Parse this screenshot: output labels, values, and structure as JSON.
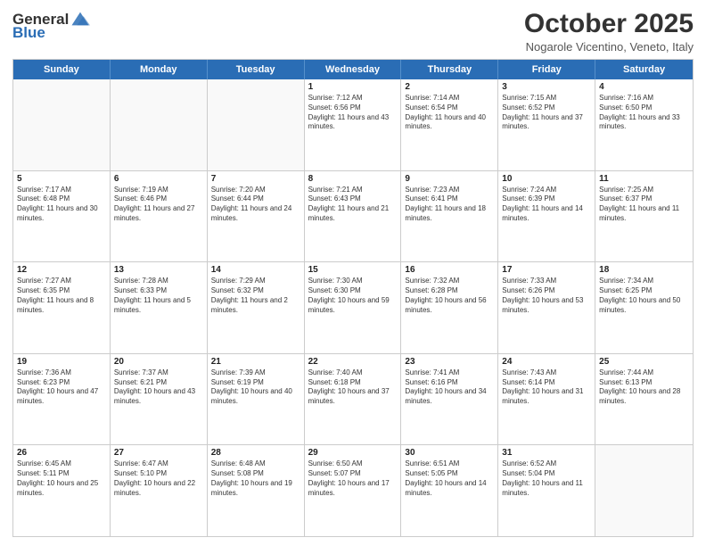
{
  "header": {
    "logo": {
      "general": "General",
      "blue": "Blue"
    },
    "title": "October 2025",
    "subtitle": "Nogarole Vicentino, Veneto, Italy"
  },
  "calendar": {
    "days_of_week": [
      "Sunday",
      "Monday",
      "Tuesday",
      "Wednesday",
      "Thursday",
      "Friday",
      "Saturday"
    ],
    "rows": [
      [
        {
          "day": "",
          "empty": true
        },
        {
          "day": "",
          "empty": true
        },
        {
          "day": "",
          "empty": true
        },
        {
          "day": "1",
          "sunrise": "Sunrise: 7:12 AM",
          "sunset": "Sunset: 6:56 PM",
          "daylight": "Daylight: 11 hours and 43 minutes."
        },
        {
          "day": "2",
          "sunrise": "Sunrise: 7:14 AM",
          "sunset": "Sunset: 6:54 PM",
          "daylight": "Daylight: 11 hours and 40 minutes."
        },
        {
          "day": "3",
          "sunrise": "Sunrise: 7:15 AM",
          "sunset": "Sunset: 6:52 PM",
          "daylight": "Daylight: 11 hours and 37 minutes."
        },
        {
          "day": "4",
          "sunrise": "Sunrise: 7:16 AM",
          "sunset": "Sunset: 6:50 PM",
          "daylight": "Daylight: 11 hours and 33 minutes."
        }
      ],
      [
        {
          "day": "5",
          "sunrise": "Sunrise: 7:17 AM",
          "sunset": "Sunset: 6:48 PM",
          "daylight": "Daylight: 11 hours and 30 minutes."
        },
        {
          "day": "6",
          "sunrise": "Sunrise: 7:19 AM",
          "sunset": "Sunset: 6:46 PM",
          "daylight": "Daylight: 11 hours and 27 minutes."
        },
        {
          "day": "7",
          "sunrise": "Sunrise: 7:20 AM",
          "sunset": "Sunset: 6:44 PM",
          "daylight": "Daylight: 11 hours and 24 minutes."
        },
        {
          "day": "8",
          "sunrise": "Sunrise: 7:21 AM",
          "sunset": "Sunset: 6:43 PM",
          "daylight": "Daylight: 11 hours and 21 minutes."
        },
        {
          "day": "9",
          "sunrise": "Sunrise: 7:23 AM",
          "sunset": "Sunset: 6:41 PM",
          "daylight": "Daylight: 11 hours and 18 minutes."
        },
        {
          "day": "10",
          "sunrise": "Sunrise: 7:24 AM",
          "sunset": "Sunset: 6:39 PM",
          "daylight": "Daylight: 11 hours and 14 minutes."
        },
        {
          "day": "11",
          "sunrise": "Sunrise: 7:25 AM",
          "sunset": "Sunset: 6:37 PM",
          "daylight": "Daylight: 11 hours and 11 minutes."
        }
      ],
      [
        {
          "day": "12",
          "sunrise": "Sunrise: 7:27 AM",
          "sunset": "Sunset: 6:35 PM",
          "daylight": "Daylight: 11 hours and 8 minutes."
        },
        {
          "day": "13",
          "sunrise": "Sunrise: 7:28 AM",
          "sunset": "Sunset: 6:33 PM",
          "daylight": "Daylight: 11 hours and 5 minutes."
        },
        {
          "day": "14",
          "sunrise": "Sunrise: 7:29 AM",
          "sunset": "Sunset: 6:32 PM",
          "daylight": "Daylight: 11 hours and 2 minutes."
        },
        {
          "day": "15",
          "sunrise": "Sunrise: 7:30 AM",
          "sunset": "Sunset: 6:30 PM",
          "daylight": "Daylight: 10 hours and 59 minutes."
        },
        {
          "day": "16",
          "sunrise": "Sunrise: 7:32 AM",
          "sunset": "Sunset: 6:28 PM",
          "daylight": "Daylight: 10 hours and 56 minutes."
        },
        {
          "day": "17",
          "sunrise": "Sunrise: 7:33 AM",
          "sunset": "Sunset: 6:26 PM",
          "daylight": "Daylight: 10 hours and 53 minutes."
        },
        {
          "day": "18",
          "sunrise": "Sunrise: 7:34 AM",
          "sunset": "Sunset: 6:25 PM",
          "daylight": "Daylight: 10 hours and 50 minutes."
        }
      ],
      [
        {
          "day": "19",
          "sunrise": "Sunrise: 7:36 AM",
          "sunset": "Sunset: 6:23 PM",
          "daylight": "Daylight: 10 hours and 47 minutes."
        },
        {
          "day": "20",
          "sunrise": "Sunrise: 7:37 AM",
          "sunset": "Sunset: 6:21 PM",
          "daylight": "Daylight: 10 hours and 43 minutes."
        },
        {
          "day": "21",
          "sunrise": "Sunrise: 7:39 AM",
          "sunset": "Sunset: 6:19 PM",
          "daylight": "Daylight: 10 hours and 40 minutes."
        },
        {
          "day": "22",
          "sunrise": "Sunrise: 7:40 AM",
          "sunset": "Sunset: 6:18 PM",
          "daylight": "Daylight: 10 hours and 37 minutes."
        },
        {
          "day": "23",
          "sunrise": "Sunrise: 7:41 AM",
          "sunset": "Sunset: 6:16 PM",
          "daylight": "Daylight: 10 hours and 34 minutes."
        },
        {
          "day": "24",
          "sunrise": "Sunrise: 7:43 AM",
          "sunset": "Sunset: 6:14 PM",
          "daylight": "Daylight: 10 hours and 31 minutes."
        },
        {
          "day": "25",
          "sunrise": "Sunrise: 7:44 AM",
          "sunset": "Sunset: 6:13 PM",
          "daylight": "Daylight: 10 hours and 28 minutes."
        }
      ],
      [
        {
          "day": "26",
          "sunrise": "Sunrise: 6:45 AM",
          "sunset": "Sunset: 5:11 PM",
          "daylight": "Daylight: 10 hours and 25 minutes."
        },
        {
          "day": "27",
          "sunrise": "Sunrise: 6:47 AM",
          "sunset": "Sunset: 5:10 PM",
          "daylight": "Daylight: 10 hours and 22 minutes."
        },
        {
          "day": "28",
          "sunrise": "Sunrise: 6:48 AM",
          "sunset": "Sunset: 5:08 PM",
          "daylight": "Daylight: 10 hours and 19 minutes."
        },
        {
          "day": "29",
          "sunrise": "Sunrise: 6:50 AM",
          "sunset": "Sunset: 5:07 PM",
          "daylight": "Daylight: 10 hours and 17 minutes."
        },
        {
          "day": "30",
          "sunrise": "Sunrise: 6:51 AM",
          "sunset": "Sunset: 5:05 PM",
          "daylight": "Daylight: 10 hours and 14 minutes."
        },
        {
          "day": "31",
          "sunrise": "Sunrise: 6:52 AM",
          "sunset": "Sunset: 5:04 PM",
          "daylight": "Daylight: 10 hours and 11 minutes."
        },
        {
          "day": "",
          "empty": true
        }
      ]
    ]
  }
}
